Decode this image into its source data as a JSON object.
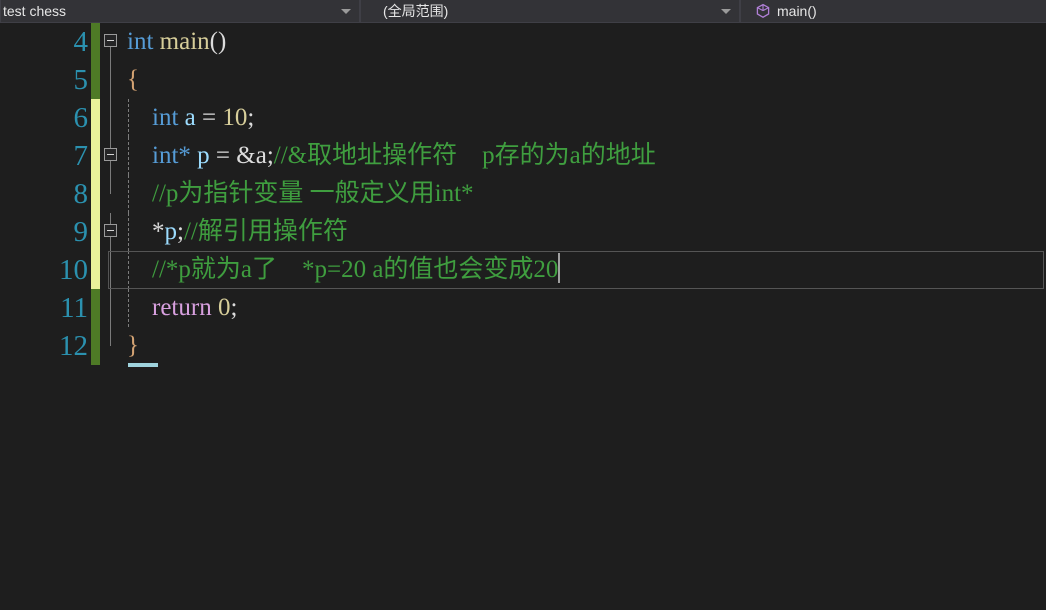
{
  "window": {
    "background_color": "#1e1e1e",
    "app_kind": "visual-studio-code-editor"
  },
  "nav_bar": {
    "project_selector": {
      "value": "test chess",
      "icon": "chevron-down-icon"
    },
    "scope_selector": {
      "value": "(全局范围)",
      "icon": "chevron-down-icon"
    },
    "member_selector": {
      "value": "main()",
      "icon": "method-cube-icon",
      "icon_color": "#b180d7"
    }
  },
  "editor": {
    "language": "c",
    "cursor_line": 10,
    "cursor_column_text": "end-of-line",
    "colors": {
      "background": "#1e1e1e",
      "line_number": "#2b91af",
      "comment": "#3f9e3f",
      "keyword": "#569cd6",
      "control_keyword": "#d8a0df",
      "variable": "#9cdcfe",
      "number": "#d7ce9a",
      "brace": "#d4a373",
      "change_saved": "#4e7a26",
      "change_unsaved": "#e9f29a",
      "caret": "#a0a0a0"
    },
    "lines": [
      {
        "number": "4",
        "change": "saved",
        "fold": "box",
        "fold_line": "half-top",
        "indent_guides": 0,
        "current": false,
        "tokens": [
          {
            "t": "int",
            "c": "kw"
          },
          {
            "t": " ",
            "c": "plain"
          },
          {
            "t": "main",
            "c": "num"
          },
          {
            "t": "()",
            "c": "plain"
          }
        ]
      },
      {
        "number": "5",
        "change": "saved",
        "fold": "line",
        "fold_line": "full",
        "indent_guides": 0,
        "current": false,
        "tokens": [
          {
            "t": "{",
            "c": "brace"
          }
        ]
      },
      {
        "number": "6",
        "change": "unsaved",
        "fold": "line",
        "fold_line": "full",
        "indent_guides": 1,
        "current": false,
        "tokens": [
          {
            "t": "    ",
            "c": "plain"
          },
          {
            "t": "int",
            "c": "kw"
          },
          {
            "t": " ",
            "c": "plain"
          },
          {
            "t": "a",
            "c": "var"
          },
          {
            "t": " = ",
            "c": "plain"
          },
          {
            "t": "10",
            "c": "num"
          },
          {
            "t": ";",
            "c": "plain"
          }
        ]
      },
      {
        "number": "7",
        "change": "unsaved",
        "fold": "box",
        "fold_line": "full",
        "indent_guides": 1,
        "current": false,
        "tokens": [
          {
            "t": "    ",
            "c": "plain"
          },
          {
            "t": "int",
            "c": "kw"
          },
          {
            "t": "*",
            "c": "kw"
          },
          {
            "t": " ",
            "c": "plain"
          },
          {
            "t": "p",
            "c": "var"
          },
          {
            "t": " = ",
            "c": "plain"
          },
          {
            "t": "&a",
            "c": "plain"
          },
          {
            "t": ";",
            "c": "plain"
          },
          {
            "t": "//&取地址操作符　p存的为a的地址",
            "c": "cmt"
          }
        ]
      },
      {
        "number": "8",
        "change": "unsaved",
        "fold": "half-bot",
        "fold_line": "half-bot",
        "indent_guides": 1,
        "current": false,
        "tokens": [
          {
            "t": "    ",
            "c": "plain"
          },
          {
            "t": "//p为指针变量 一般定义用int*",
            "c": "cmt"
          }
        ]
      },
      {
        "number": "9",
        "change": "unsaved",
        "fold": "box",
        "fold_line": "full",
        "indent_guides": 1,
        "current": false,
        "tokens": [
          {
            "t": "    ",
            "c": "plain"
          },
          {
            "t": "*",
            "c": "plain"
          },
          {
            "t": "p",
            "c": "var"
          },
          {
            "t": ";",
            "c": "plain"
          },
          {
            "t": "//解引用操作符",
            "c": "cmt"
          }
        ]
      },
      {
        "number": "10",
        "change": "unsaved",
        "fold": "line",
        "fold_line": "full",
        "indent_guides": 1,
        "current": true,
        "tokens": [
          {
            "t": "    ",
            "c": "plain"
          },
          {
            "t": "//*p就为a了　*p=20 a的值也会变成20",
            "c": "cmt"
          }
        ]
      },
      {
        "number": "11",
        "change": "saved",
        "fold": "line",
        "fold_line": "full",
        "indent_guides": 1,
        "current": false,
        "tokens": [
          {
            "t": "    ",
            "c": "plain"
          },
          {
            "t": "return",
            "c": "kw-ctrl"
          },
          {
            "t": " ",
            "c": "plain"
          },
          {
            "t": "0",
            "c": "num"
          },
          {
            "t": ";",
            "c": "plain"
          }
        ]
      },
      {
        "number": "12",
        "change": "saved",
        "fold": "half-bot",
        "fold_line": "half-bot",
        "indent_guides": 0,
        "current": false,
        "end_underline": true,
        "tokens": [
          {
            "t": "}",
            "c": "brace"
          }
        ]
      }
    ]
  }
}
